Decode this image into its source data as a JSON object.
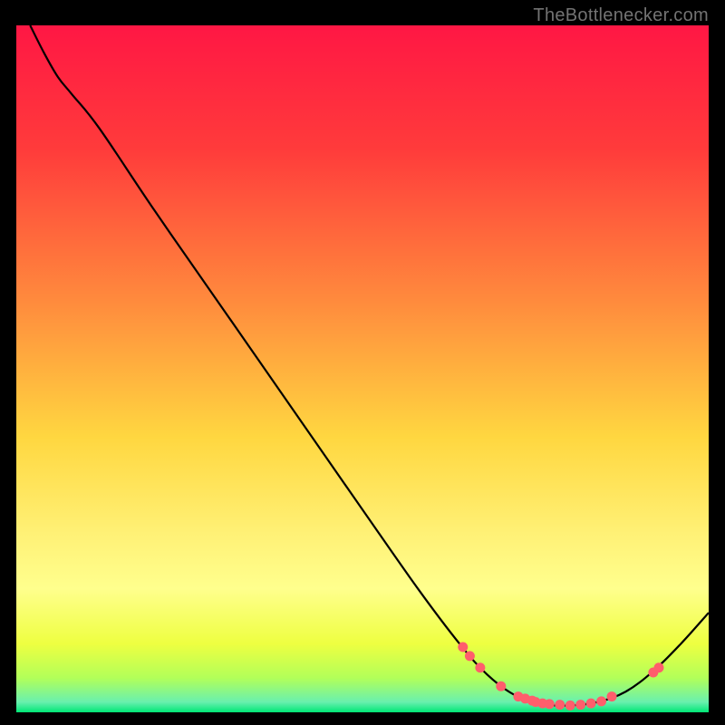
{
  "watermark": "TheBottlenecker.com",
  "chart_data": {
    "type": "line",
    "title": "",
    "xlabel": "",
    "ylabel": "",
    "xlim": [
      0,
      100
    ],
    "ylim": [
      0,
      100
    ],
    "gradient_stops": [
      {
        "offset": 0.0,
        "color": "#ff1744"
      },
      {
        "offset": 0.18,
        "color": "#ff3b3b"
      },
      {
        "offset": 0.4,
        "color": "#ff8a3d"
      },
      {
        "offset": 0.6,
        "color": "#ffd740"
      },
      {
        "offset": 0.74,
        "color": "#fff176"
      },
      {
        "offset": 0.82,
        "color": "#ffff8d"
      },
      {
        "offset": 0.9,
        "color": "#eeff41"
      },
      {
        "offset": 0.95,
        "color": "#b2ff59"
      },
      {
        "offset": 0.985,
        "color": "#69f0ae"
      },
      {
        "offset": 1.0,
        "color": "#00e676"
      }
    ],
    "series": [
      {
        "name": "curve",
        "points": [
          {
            "x": 2.0,
            "y": 100.0
          },
          {
            "x": 4.0,
            "y": 96.0
          },
          {
            "x": 6.0,
            "y": 92.5
          },
          {
            "x": 8.0,
            "y": 90.0
          },
          {
            "x": 12.0,
            "y": 85.0
          },
          {
            "x": 20.0,
            "y": 73.0
          },
          {
            "x": 30.0,
            "y": 58.5
          },
          {
            "x": 40.0,
            "y": 44.0
          },
          {
            "x": 50.0,
            "y": 29.5
          },
          {
            "x": 58.0,
            "y": 18.0
          },
          {
            "x": 64.0,
            "y": 10.0
          },
          {
            "x": 68.0,
            "y": 5.5
          },
          {
            "x": 72.0,
            "y": 2.5
          },
          {
            "x": 76.0,
            "y": 1.2
          },
          {
            "x": 80.0,
            "y": 1.0
          },
          {
            "x": 84.0,
            "y": 1.5
          },
          {
            "x": 88.0,
            "y": 3.0
          },
          {
            "x": 92.0,
            "y": 6.0
          },
          {
            "x": 96.0,
            "y": 10.0
          },
          {
            "x": 100.0,
            "y": 14.5
          }
        ]
      }
    ],
    "markers": [
      {
        "x": 64.5,
        "y": 9.5
      },
      {
        "x": 65.5,
        "y": 8.2
      },
      {
        "x": 67.0,
        "y": 6.5
      },
      {
        "x": 70.0,
        "y": 3.8
      },
      {
        "x": 72.5,
        "y": 2.3
      },
      {
        "x": 73.5,
        "y": 2.0
      },
      {
        "x": 74.5,
        "y": 1.7
      },
      {
        "x": 75.0,
        "y": 1.5
      },
      {
        "x": 76.0,
        "y": 1.3
      },
      {
        "x": 77.0,
        "y": 1.2
      },
      {
        "x": 78.5,
        "y": 1.1
      },
      {
        "x": 80.0,
        "y": 1.0
      },
      {
        "x": 81.5,
        "y": 1.1
      },
      {
        "x": 83.0,
        "y": 1.3
      },
      {
        "x": 84.5,
        "y": 1.6
      },
      {
        "x": 86.0,
        "y": 2.3
      },
      {
        "x": 92.0,
        "y": 5.8
      },
      {
        "x": 92.8,
        "y": 6.5
      }
    ],
    "marker_color": "#ff5e6c",
    "marker_radius": 5.5
  }
}
